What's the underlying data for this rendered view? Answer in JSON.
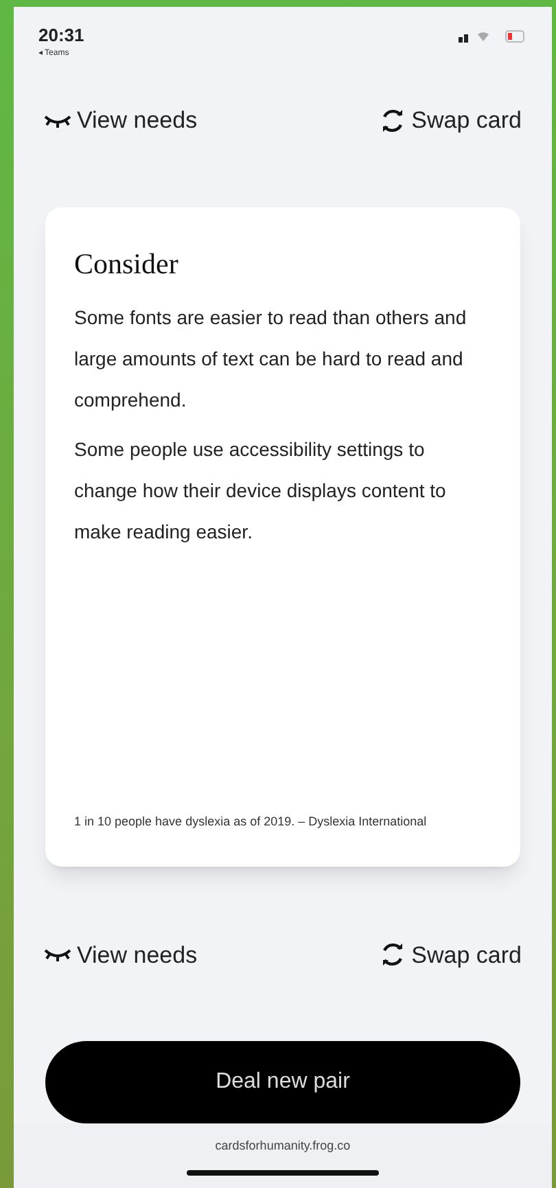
{
  "status_bar": {
    "time": "20:31",
    "back_label": "◂ Teams"
  },
  "top_actions": {
    "view_needs": "View needs",
    "swap_card": "Swap card"
  },
  "card": {
    "title": "Consider",
    "paragraphs": [
      "Some fonts are easier to read than others and large amounts of text can be hard to read and comprehend.",
      "Some people use accessibility settings to change how their device displays content to make reading easier."
    ],
    "footnote": "1 in 10 people have dyslexia as of 2019. – Dyslexia International"
  },
  "bottom_actions": {
    "view_needs": "View needs",
    "swap_card": "Swap card"
  },
  "primary_button": "Deal new pair",
  "browser_bar": {
    "url": "cardsforhumanity.frog.co"
  }
}
